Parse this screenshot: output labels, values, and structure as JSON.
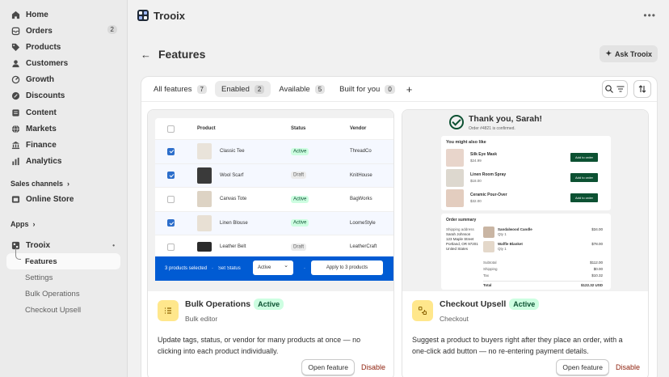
{
  "sidebar": {
    "nav": [
      {
        "label": "Home",
        "icon": "home-icon"
      },
      {
        "label": "Orders",
        "icon": "orders-icon",
        "badge": "2"
      },
      {
        "label": "Products",
        "icon": "tag-icon"
      },
      {
        "label": "Customers",
        "icon": "person-icon"
      },
      {
        "label": "Growth",
        "icon": "growth-icon"
      },
      {
        "label": "Discounts",
        "icon": "discount-icon"
      },
      {
        "label": "Content",
        "icon": "content-icon"
      },
      {
        "label": "Markets",
        "icon": "globe-icon"
      },
      {
        "label": "Finance",
        "icon": "bank-icon"
      },
      {
        "label": "Analytics",
        "icon": "chart-icon"
      }
    ],
    "sales_channels_label": "Sales channels",
    "online_store_label": "Online Store",
    "apps_label": "Apps",
    "app_name": "Trooix",
    "app_sub": [
      "Features",
      "Settings",
      "Bulk Operations",
      "Checkout Upsell"
    ]
  },
  "topbar": {
    "title": "Trooix"
  },
  "page": {
    "title": "Features",
    "ask_label": "Ask Trooix"
  },
  "tabs": [
    {
      "label": "All features",
      "count": "7"
    },
    {
      "label": "Enabled",
      "count": "2"
    },
    {
      "label": "Available",
      "count": "5"
    },
    {
      "label": "Built for you",
      "count": "0"
    }
  ],
  "bulk_preview": {
    "headers": [
      "Product",
      "Status",
      "Vendor"
    ],
    "rows": [
      {
        "name": "Classic Tee",
        "status": "Active",
        "vendor": "ThreadCo",
        "checked": true
      },
      {
        "name": "Wool Scarf",
        "status": "Draft",
        "vendor": "KnitHouse",
        "checked": true
      },
      {
        "name": "Canvas Tote",
        "status": "Active",
        "vendor": "BagWorks",
        "checked": false
      },
      {
        "name": "Linen Blouse",
        "status": "Active",
        "vendor": "LoomeStyle",
        "checked": true
      },
      {
        "name": "Leather Belt",
        "status": "Draft",
        "vendor": "LeatherCraft",
        "checked": false
      }
    ],
    "bar_selected": "3 products selected",
    "bar_set_status": "Set Status",
    "bar_dropdown": "Active",
    "bar_apply": "Apply to 3 products"
  },
  "checkout_preview": {
    "title": "Thank you, Sarah!",
    "subtitle": "Order #4821 is confirmed.",
    "upsell_title": "You might also like",
    "upsell_items": [
      {
        "name": "Silk Eye Mask",
        "price": "$24.99",
        "button": "Add to order"
      },
      {
        "name": "Linen Room Spray",
        "price": "$18.00",
        "button": "Add to order"
      },
      {
        "name": "Ceramic Pour-Over",
        "price": "$32.00",
        "button": "Add to order"
      }
    ],
    "summary_title": "Order summary",
    "address_label": "Shipping address",
    "address_lines": [
      "Sarah Johnson",
      "123 Maple Street",
      "Portland, OR 97201",
      "United States"
    ],
    "summary_items": [
      {
        "name": "Sandalwood Candle",
        "qty": "Qty 1",
        "price": "$34.00"
      },
      {
        "name": "Waffle Blanket",
        "qty": "Qty 1",
        "price": "$78.00"
      }
    ],
    "lines": [
      {
        "label": "Subtotal",
        "value": "$112.00"
      },
      {
        "label": "Shipping",
        "value": "$0.00"
      },
      {
        "label": "Tax",
        "value": "$10.32"
      }
    ],
    "total": {
      "label": "Total",
      "value": "$122.32 USD"
    }
  },
  "features": [
    {
      "name": "Bulk Operations",
      "badge": "Active",
      "category": "Bulk editor",
      "description": "Update tags, status, or vendor for many products at once — no clicking into each product individually.",
      "open_label": "Open feature",
      "disable_label": "Disable"
    },
    {
      "name": "Checkout Upsell",
      "badge": "Active",
      "category": "Checkout",
      "description": "Suggest a product to buyers right after they place an order, with a one-click add button — no re-entering payment details.",
      "open_label": "Open feature",
      "disable_label": "Disable"
    }
  ],
  "colors": {
    "active_bg": "#cdfee1",
    "active_text": "#0c5132",
    "primary_blue": "#005bd3",
    "icon_bg": "#ffe78c",
    "disable": "#8e1f0b"
  }
}
